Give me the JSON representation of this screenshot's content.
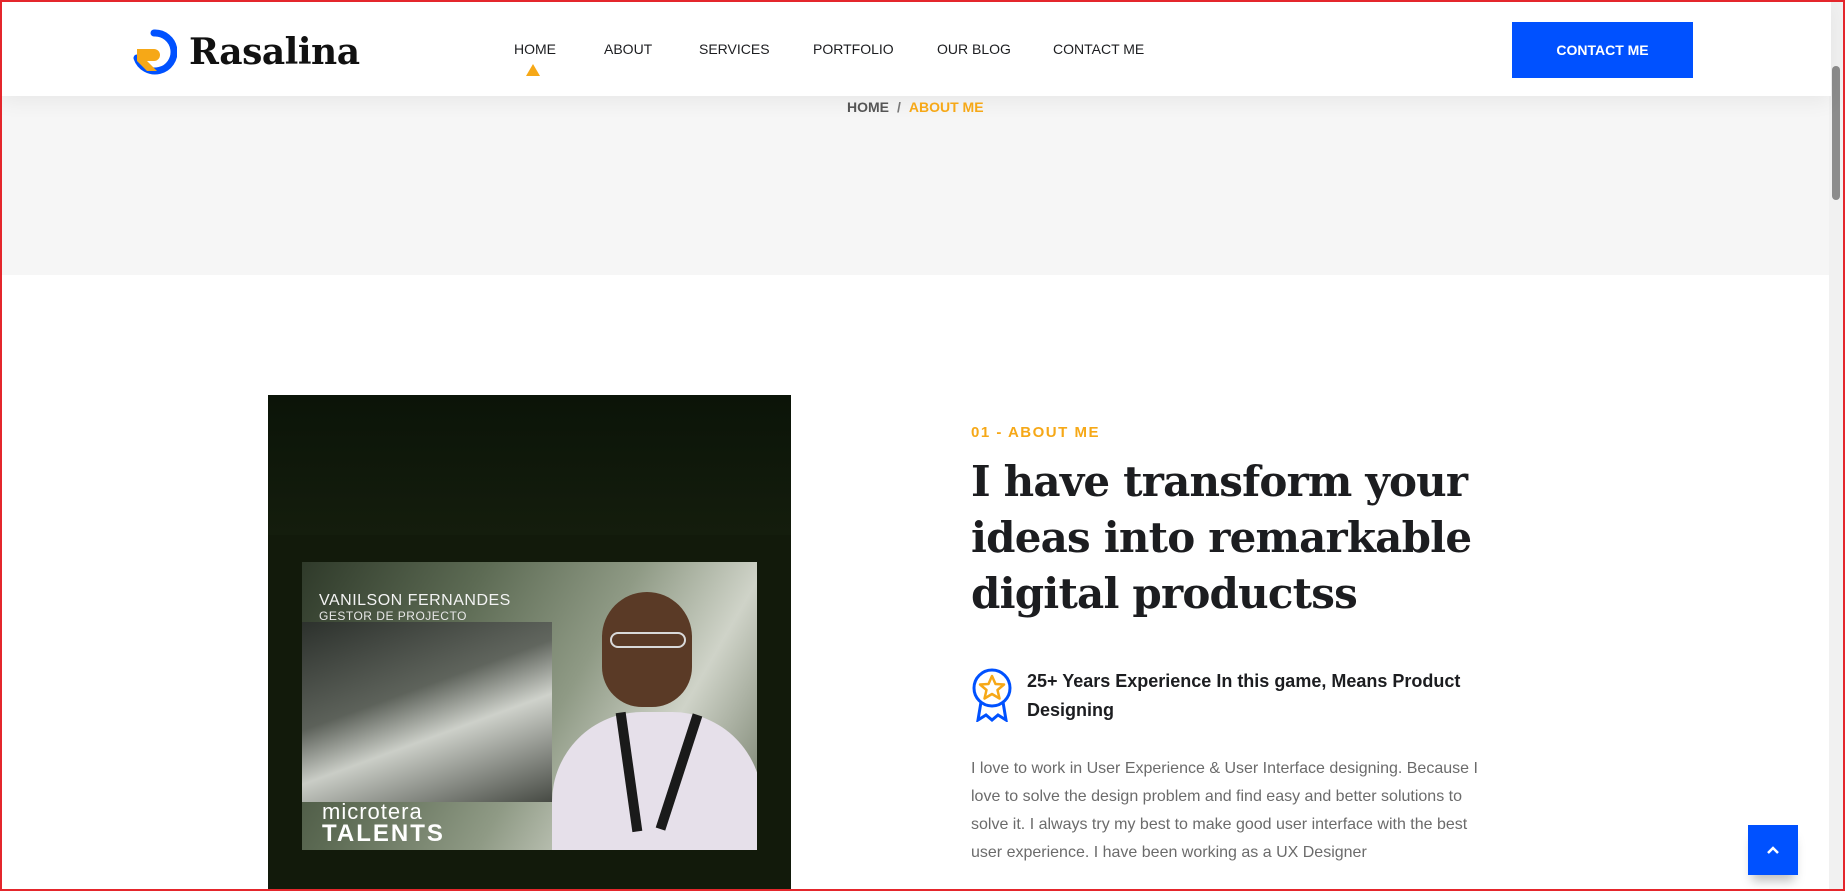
{
  "brand": {
    "name": "Rasalina",
    "colors": {
      "accent": "#f6a817",
      "primary": "#0051ff"
    }
  },
  "nav": {
    "items": [
      {
        "label": "HOME",
        "active": true
      },
      {
        "label": "ABOUT"
      },
      {
        "label": "SERVICES"
      },
      {
        "label": "PORTFOLIO"
      },
      {
        "label": "OUR BLOG"
      },
      {
        "label": "CONTACT ME"
      }
    ],
    "cta_label": "CONTACT ME"
  },
  "breadcrumb": {
    "home": "HOME",
    "separator": "/",
    "current": "ABOUT ME"
  },
  "about": {
    "subtitle": "01 - ABOUT ME",
    "headline": "I have transform your ideas into remarkable digital productss",
    "experience": "25+ Years Experience In this game, Means Product Designing",
    "description": "I love to work in User Experience & User Interface designing. Because I love to solve the design problem and find easy and better solutions to solve it. I always try my best to make good user interface with the best user experience. I have been working as a UX Designer",
    "photo": {
      "name": "VANILSON FERNANDES",
      "role": "GESTOR DE PROJECTO",
      "brand_line1": "microtera",
      "brand_line2": "TALENTS"
    }
  },
  "icons": {
    "logo": "logo-mark-icon",
    "experience": "award-badge-icon",
    "back_to_top": "chevron-up-icon"
  }
}
